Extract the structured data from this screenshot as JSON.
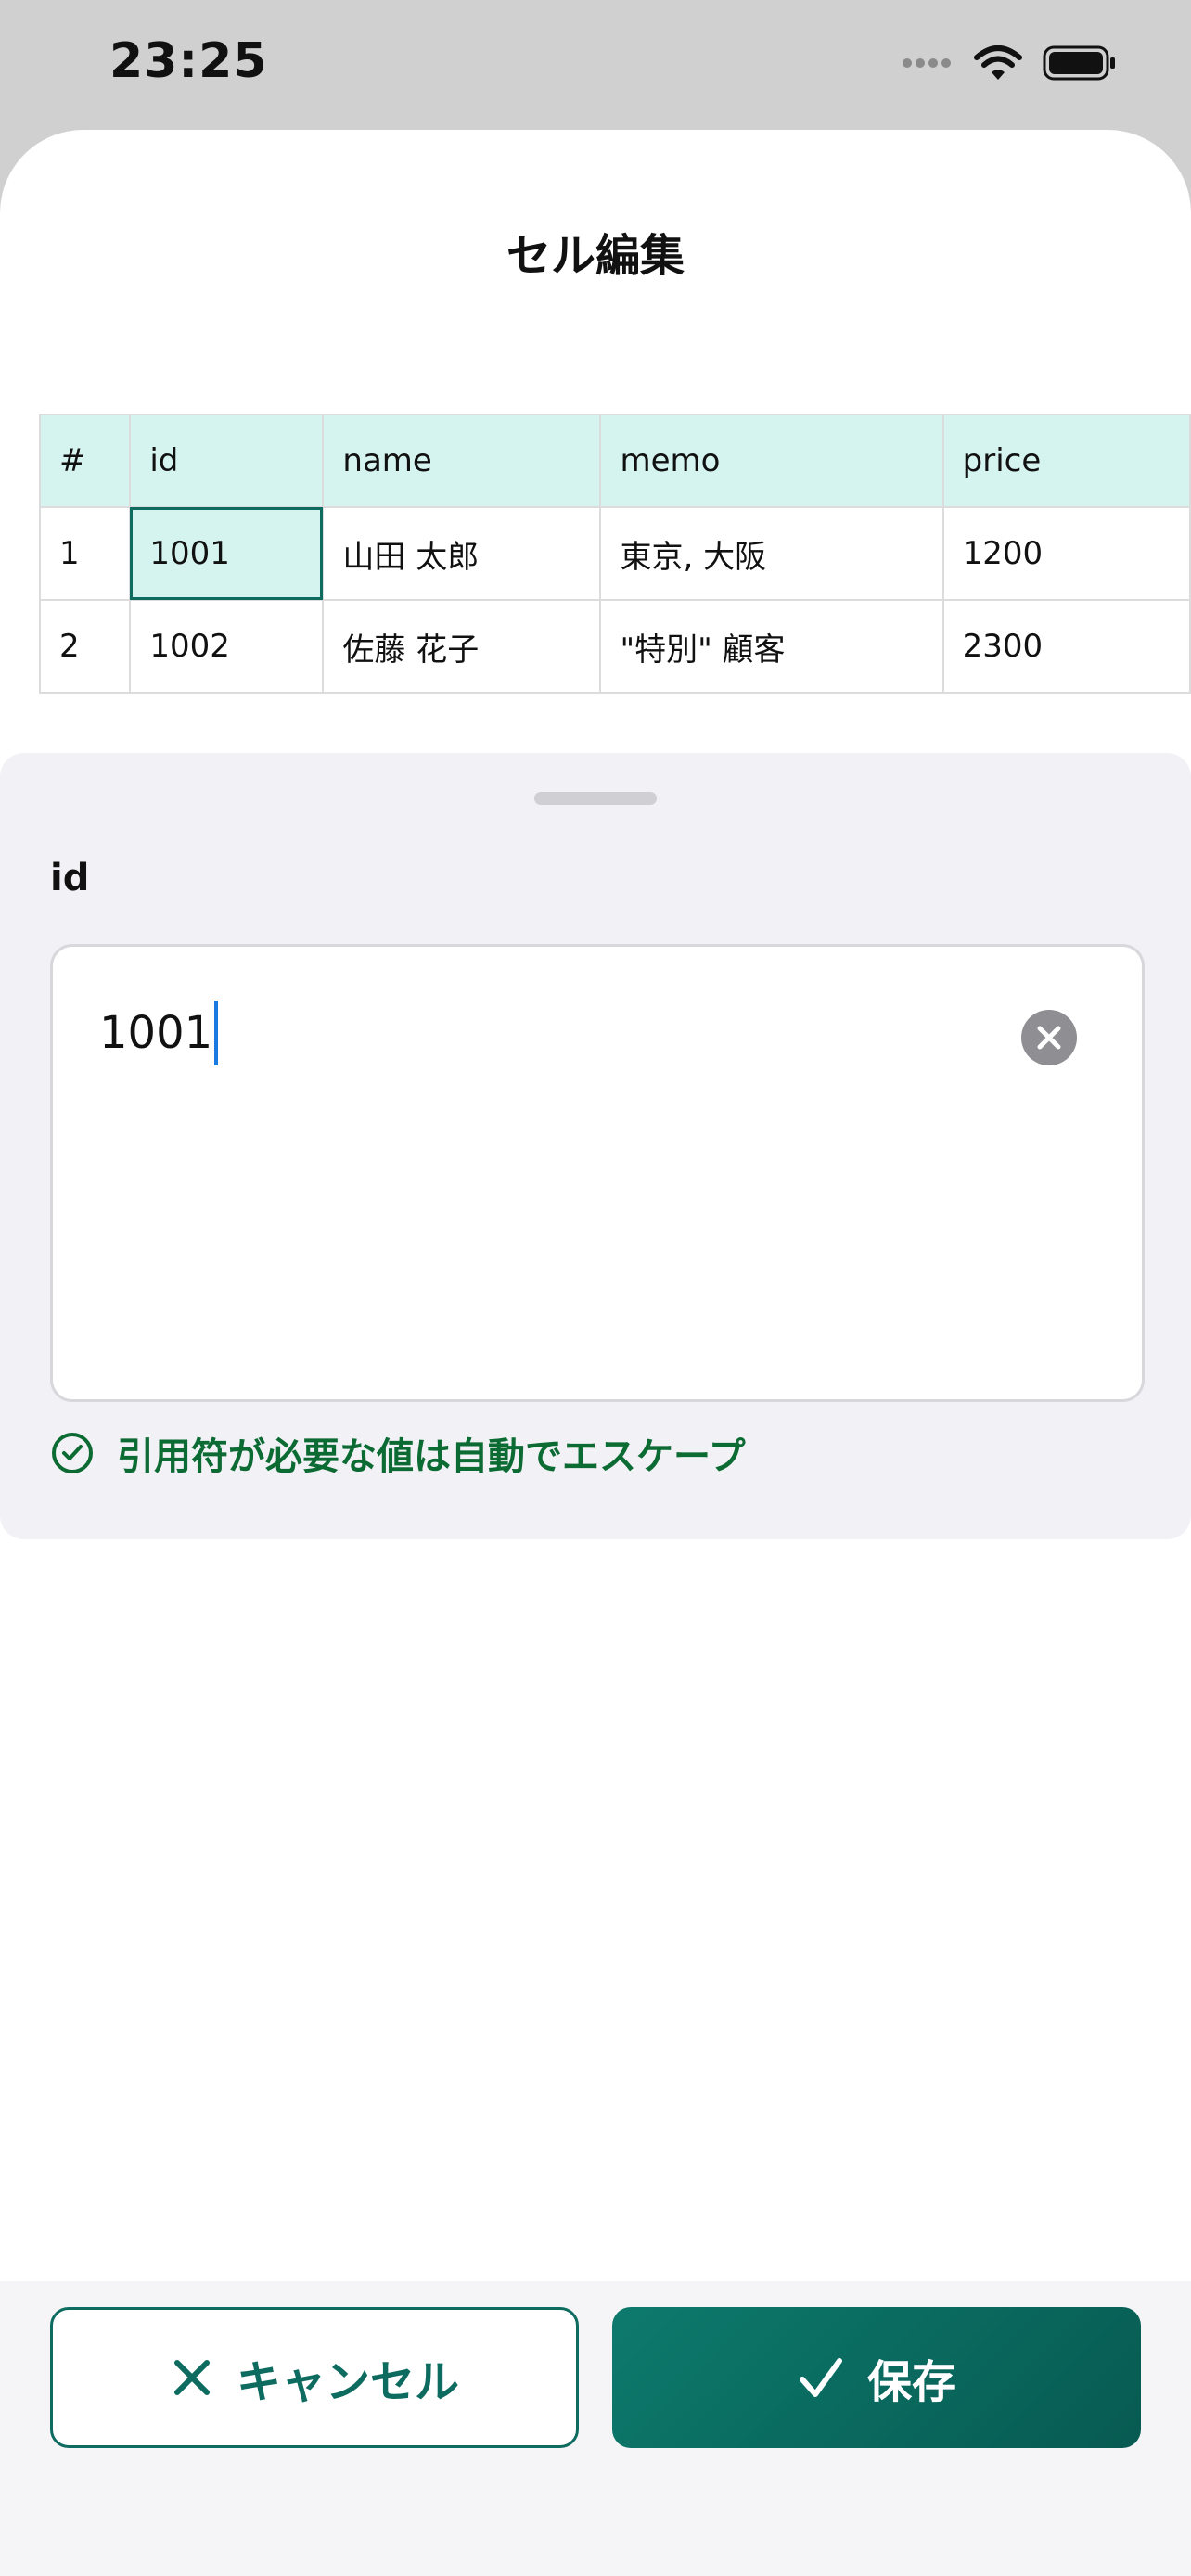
{
  "status_bar": {
    "time": "23:25"
  },
  "sheet": {
    "title": "セル編集"
  },
  "table": {
    "headers": [
      "#",
      "id",
      "name",
      "memo",
      "price"
    ],
    "rows": [
      [
        "1",
        "1001",
        "山田 太郎",
        "東京, 大阪",
        "1200"
      ],
      [
        "2",
        "1002",
        "佐藤 花子",
        "\"特別\" 顧客",
        "2300"
      ]
    ],
    "selected_cell": {
      "row": 1,
      "column": "id"
    }
  },
  "editor": {
    "field_label": "id",
    "value": "1001",
    "note": "引用符が必要な値は自動でエスケープ"
  },
  "actions": {
    "cancel_label": "キャンセル",
    "save_label": "保存"
  },
  "colors": {
    "accent": "#0e6b60",
    "header_bg": "#d5f3ef",
    "note": "#0c6b33",
    "panel_bg": "#f1f1f6"
  },
  "icons": [
    "cellular-signal-icon",
    "wifi-icon",
    "battery-icon",
    "clear-text-icon",
    "checkmark-circle-icon",
    "close-icon",
    "checkmark-icon"
  ]
}
